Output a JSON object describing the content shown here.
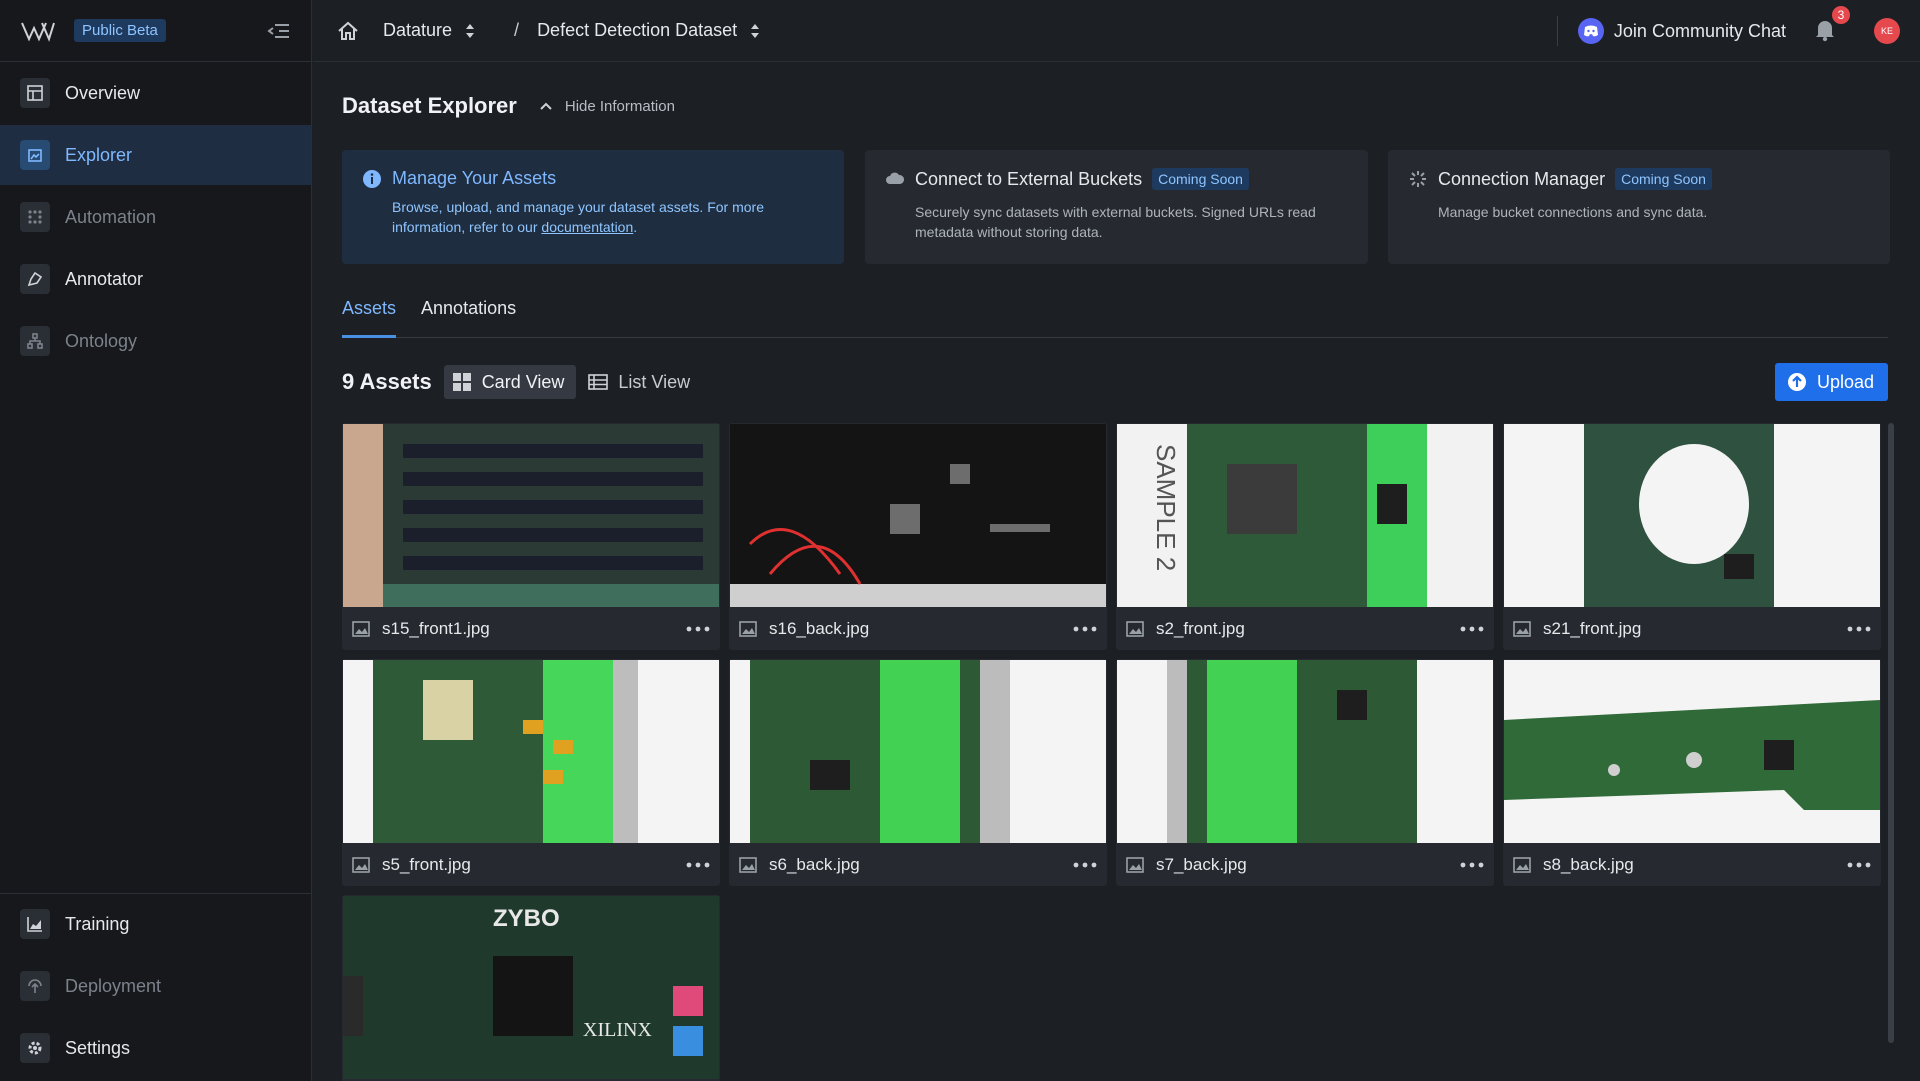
{
  "sidebar": {
    "beta_label": "Public Beta",
    "items": [
      {
        "label": "Overview",
        "icon": "dashboard-icon"
      },
      {
        "label": "Explorer",
        "icon": "folder-image-icon"
      },
      {
        "label": "Automation",
        "icon": "automation-grid-icon"
      },
      {
        "label": "Annotator",
        "icon": "pen-icon"
      },
      {
        "label": "Ontology",
        "icon": "hierarchy-icon"
      }
    ],
    "bottom_items": [
      {
        "label": "Training",
        "icon": "chart-icon"
      },
      {
        "label": "Deployment",
        "icon": "rocket-icon"
      },
      {
        "label": "Settings",
        "icon": "gear-icon"
      }
    ]
  },
  "header": {
    "workspace": "Datature",
    "separator": "/",
    "project": "Defect Detection Dataset",
    "community_label": "Join Community Chat",
    "notification_count": "3",
    "avatar_initials": "KE"
  },
  "page": {
    "title": "Dataset Explorer",
    "hide_info_label": "Hide Information"
  },
  "info_cards": [
    {
      "title": "Manage Your Assets",
      "desc_prefix": "Browse, upload, and manage your dataset assets. For more information, refer to our ",
      "link_text": "documentation",
      "desc_suffix": "."
    },
    {
      "title": "Connect to External Buckets",
      "badge": "Coming Soon",
      "desc": "Securely sync datasets with external buckets. Signed URLs read metadata without storing data."
    },
    {
      "title": "Connection Manager",
      "badge": "Coming Soon",
      "desc": "Manage bucket connections and sync data."
    }
  ],
  "tabs": [
    "Assets",
    "Annotations"
  ],
  "toolbar": {
    "asset_count": "9 Assets",
    "card_view_label": "Card View",
    "list_view_label": "List View",
    "upload_label": "Upload"
  },
  "assets": [
    {
      "name": "s15_front1.jpg"
    },
    {
      "name": "s16_back.jpg"
    },
    {
      "name": "s2_front.jpg",
      "overlay_text": "SAMPLE 2"
    },
    {
      "name": "s21_front.jpg"
    },
    {
      "name": "s5_front.jpg"
    },
    {
      "name": "s6_back.jpg"
    },
    {
      "name": "s7_back.jpg"
    },
    {
      "name": "s8_back.jpg"
    },
    {
      "name": "",
      "overlay_text": "ZYBO",
      "overlay_text_2": "XILINX"
    }
  ],
  "colors": {
    "accent": "#4a90e2",
    "badge_bg": "#1e3a5f",
    "upload_bg": "#1f6feb",
    "notification": "#e5484d"
  }
}
